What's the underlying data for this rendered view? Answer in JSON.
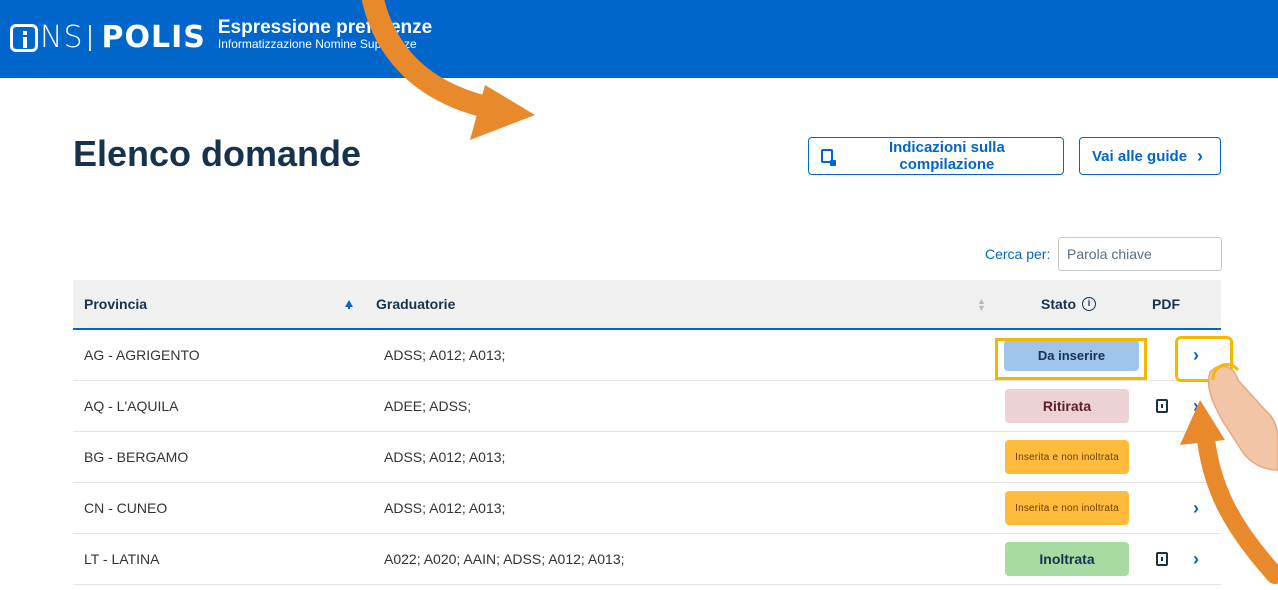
{
  "header": {
    "brand_ins": "NS",
    "brand_polis": "POLIS",
    "app_title": "Espressione preferenze",
    "app_subtitle": "Informatizzazione Nomine Supplenze"
  },
  "page": {
    "title": "Elenco domande",
    "btn_indicazioni": "Indicazioni sulla compilazione",
    "btn_guide": "Vai alle guide"
  },
  "search": {
    "label": "Cerca per:",
    "placeholder": "Parola chiave"
  },
  "table": {
    "headers": {
      "provincia": "Provincia",
      "graduatorie": "Graduatorie",
      "stato": "Stato",
      "pdf": "PDF"
    },
    "rows": [
      {
        "provincia": "AG - AGRIGENTO",
        "graduatorie": "ADSS; A012; A013;",
        "stato": "Da inserire",
        "status_color": "blue",
        "pdf": false
      },
      {
        "provincia": "AQ - L'AQUILA",
        "graduatorie": "ADEE; ADSS;",
        "stato": "Ritirata",
        "status_color": "pink",
        "pdf": true
      },
      {
        "provincia": "BG - BERGAMO",
        "graduatorie": "ADSS; A012; A013;",
        "stato": "Inserita e non inoltrata",
        "status_color": "amber",
        "pdf": false
      },
      {
        "provincia": "CN - CUNEO",
        "graduatorie": "ADSS; A012; A013;",
        "stato": "Inserita e non inoltrata",
        "status_color": "amber",
        "pdf": false
      },
      {
        "provincia": "LT - LATINA",
        "graduatorie": "A022; A020; AAIN; ADSS; A012; A013;",
        "stato": "Inoltrata",
        "status_color": "green",
        "pdf": true
      }
    ]
  },
  "colors": {
    "header_bg": "#0066cc",
    "title": "#17324d",
    "accent": "#0066cc",
    "badge_blue": "#9fc5ec",
    "badge_pink": "#ecd1d5",
    "badge_amber": "#ffbb3c",
    "badge_green": "#a8dba1",
    "annotation_orange": "#e8892c",
    "highlight_yellow": "#f5b800"
  },
  "icons": {
    "pdf": "pdf-file-icon",
    "row_arrow": "chevron-right-icon",
    "info": "info-circle-icon",
    "guide_doc": "document-icon"
  }
}
